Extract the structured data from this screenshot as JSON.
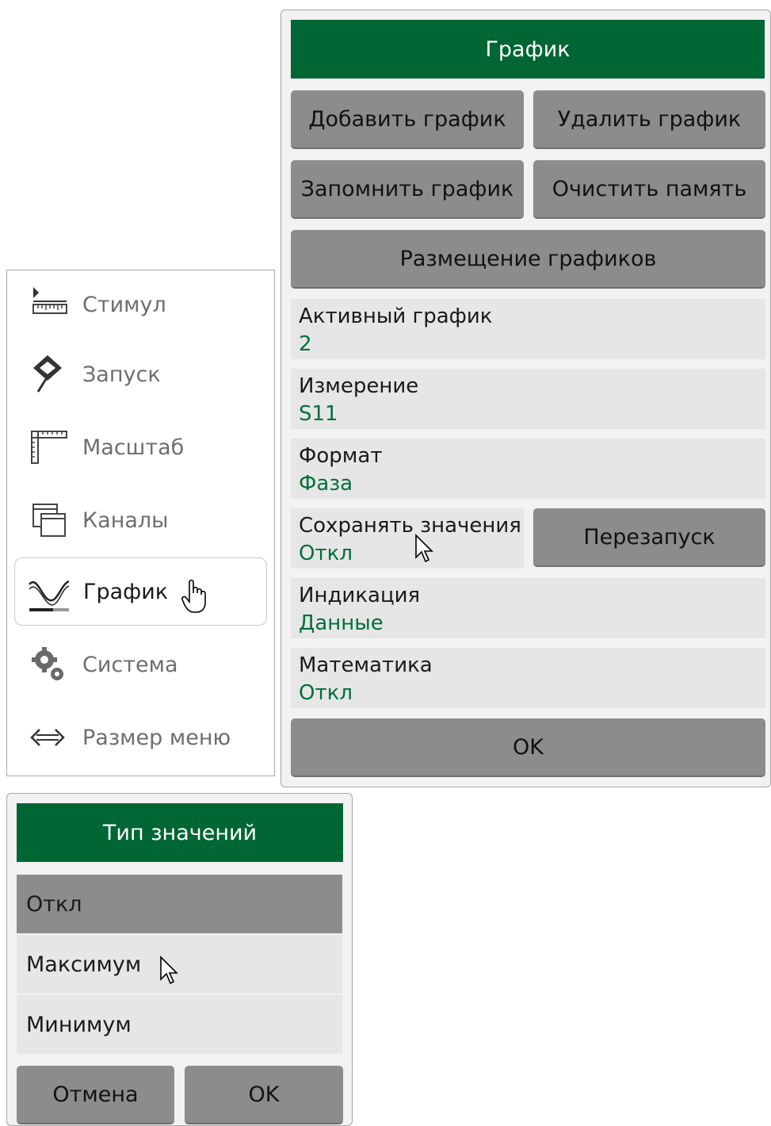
{
  "side_menu": {
    "items": [
      {
        "label": "Стимул",
        "icon": "stimulus-ruler-icon"
      },
      {
        "label": "Запуск",
        "icon": "trigger-diamond-icon"
      },
      {
        "label": "Масштаб",
        "icon": "scale-square-icon"
      },
      {
        "label": "Каналы",
        "icon": "channels-windows-icon"
      },
      {
        "label": "График",
        "icon": "trace-wave-icon",
        "active": true
      },
      {
        "label": "Система",
        "icon": "system-gears-icon"
      },
      {
        "label": "Размер меню",
        "icon": "menu-size-arrows-icon"
      }
    ]
  },
  "panel": {
    "title": "График",
    "buttons": {
      "add_trace": "Добавить график",
      "delete_trace": "Удалить график",
      "memorize_trace": "Запомнить график",
      "clear_memory": "Очистить память",
      "allocate_traces": "Размещение графиков",
      "restart": "Перезапуск",
      "ok": "OK"
    },
    "fields": {
      "active_trace": {
        "label": "Активный график",
        "value": "2"
      },
      "measurement": {
        "label": "Измерение",
        "value": "S11"
      },
      "format": {
        "label": "Формат",
        "value": "Фаза"
      },
      "hold": {
        "label": "Сохранять значения",
        "value": "Откл"
      },
      "display": {
        "label": "Индикация",
        "value": "Данные"
      },
      "math": {
        "label": "Математика",
        "value": "Откл"
      }
    }
  },
  "dialog": {
    "title": "Тип значений",
    "options": [
      {
        "label": "Откл",
        "selected": true
      },
      {
        "label": "Максимум",
        "selected": false
      },
      {
        "label": "Минимум",
        "selected": false
      }
    ],
    "cancel": "Отмена",
    "ok": "OK"
  },
  "colors": {
    "title_bg": "#006633",
    "value_text": "#00703c",
    "button_bg": "#8c8c8c",
    "field_bg": "#e6e6e6"
  }
}
